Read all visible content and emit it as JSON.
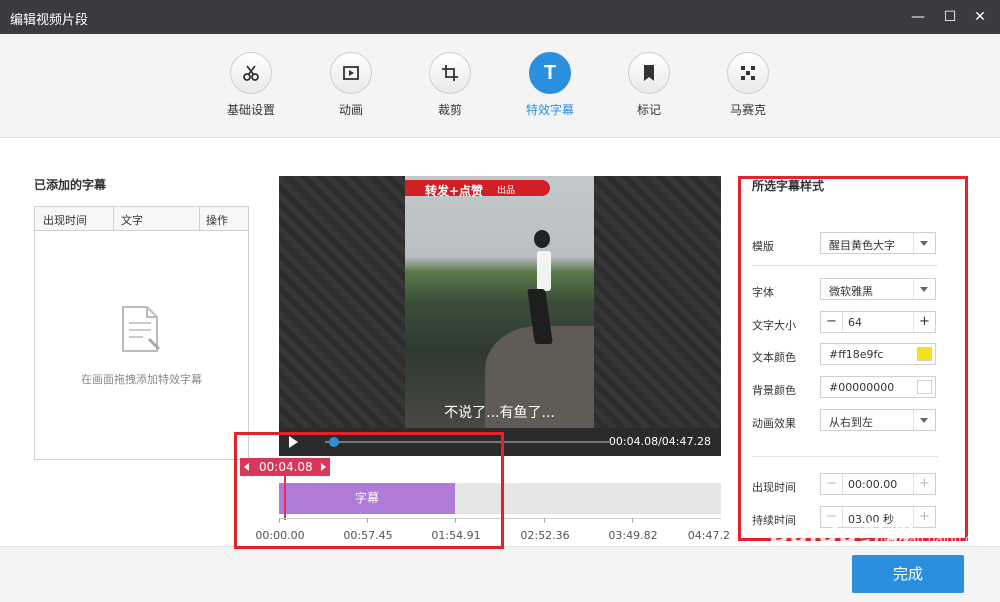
{
  "window": {
    "title": "编辑视频片段",
    "minimize": "—",
    "maximize": "☐",
    "close": "✕"
  },
  "toolbar": {
    "tabs": [
      {
        "label": "基础设置",
        "icon": "scissors-icon"
      },
      {
        "label": "动画",
        "icon": "animation-icon"
      },
      {
        "label": "裁剪",
        "icon": "crop-icon"
      },
      {
        "label": "特效字幕",
        "icon": "text-t-icon",
        "active": true
      },
      {
        "label": "标记",
        "icon": "bookmark-icon"
      },
      {
        "label": "马赛克",
        "icon": "mosaic-icon"
      }
    ]
  },
  "left": {
    "title": "已添加的字幕",
    "columns": [
      "出现时间",
      "文字",
      "操作"
    ],
    "empty_hint": "在画面拖拽添加特效字幕"
  },
  "preview": {
    "banner": "转发+点赞",
    "banner_sub": "出品",
    "subtitle": "不说了...有鱼了..."
  },
  "player": {
    "timecode": "00:04.08/04:47.28",
    "progress": 0.014
  },
  "timeline": {
    "marker": "00:04.08",
    "clip_label": "字幕",
    "ticks": [
      "00:00.00",
      "00:57.45",
      "01:54.91",
      "02:52.36",
      "03:49.82",
      "04:47.2"
    ]
  },
  "right": {
    "title": "所选字幕样式",
    "template_label": "模版",
    "template_value": "醒目黄色大字",
    "font_label": "字体",
    "font_value": "微软雅黑",
    "size_label": "文字大小",
    "size_value": "64",
    "text_color_label": "文本颜色",
    "text_color_value": "#ff18e9fc",
    "bg_color_label": "背景颜色",
    "bg_color_value": "#00000000",
    "effect_label": "动画效果",
    "effect_value": "从右到左",
    "appear_label": "出现时间",
    "appear_value": "00:00.00",
    "duration_label": "持续时间",
    "duration_value": "03.00 秒"
  },
  "footer": {
    "done_label": "完成"
  },
  "watermark": {
    "main": "Baidu经验",
    "sub": "jingyan.baidu.com"
  },
  "colors": {
    "accent": "#2b8fe0",
    "highlight": "#e3232c",
    "marker": "#d9365b",
    "clip": "#b07ad8",
    "swatch_yellow": "#f5e11a"
  }
}
